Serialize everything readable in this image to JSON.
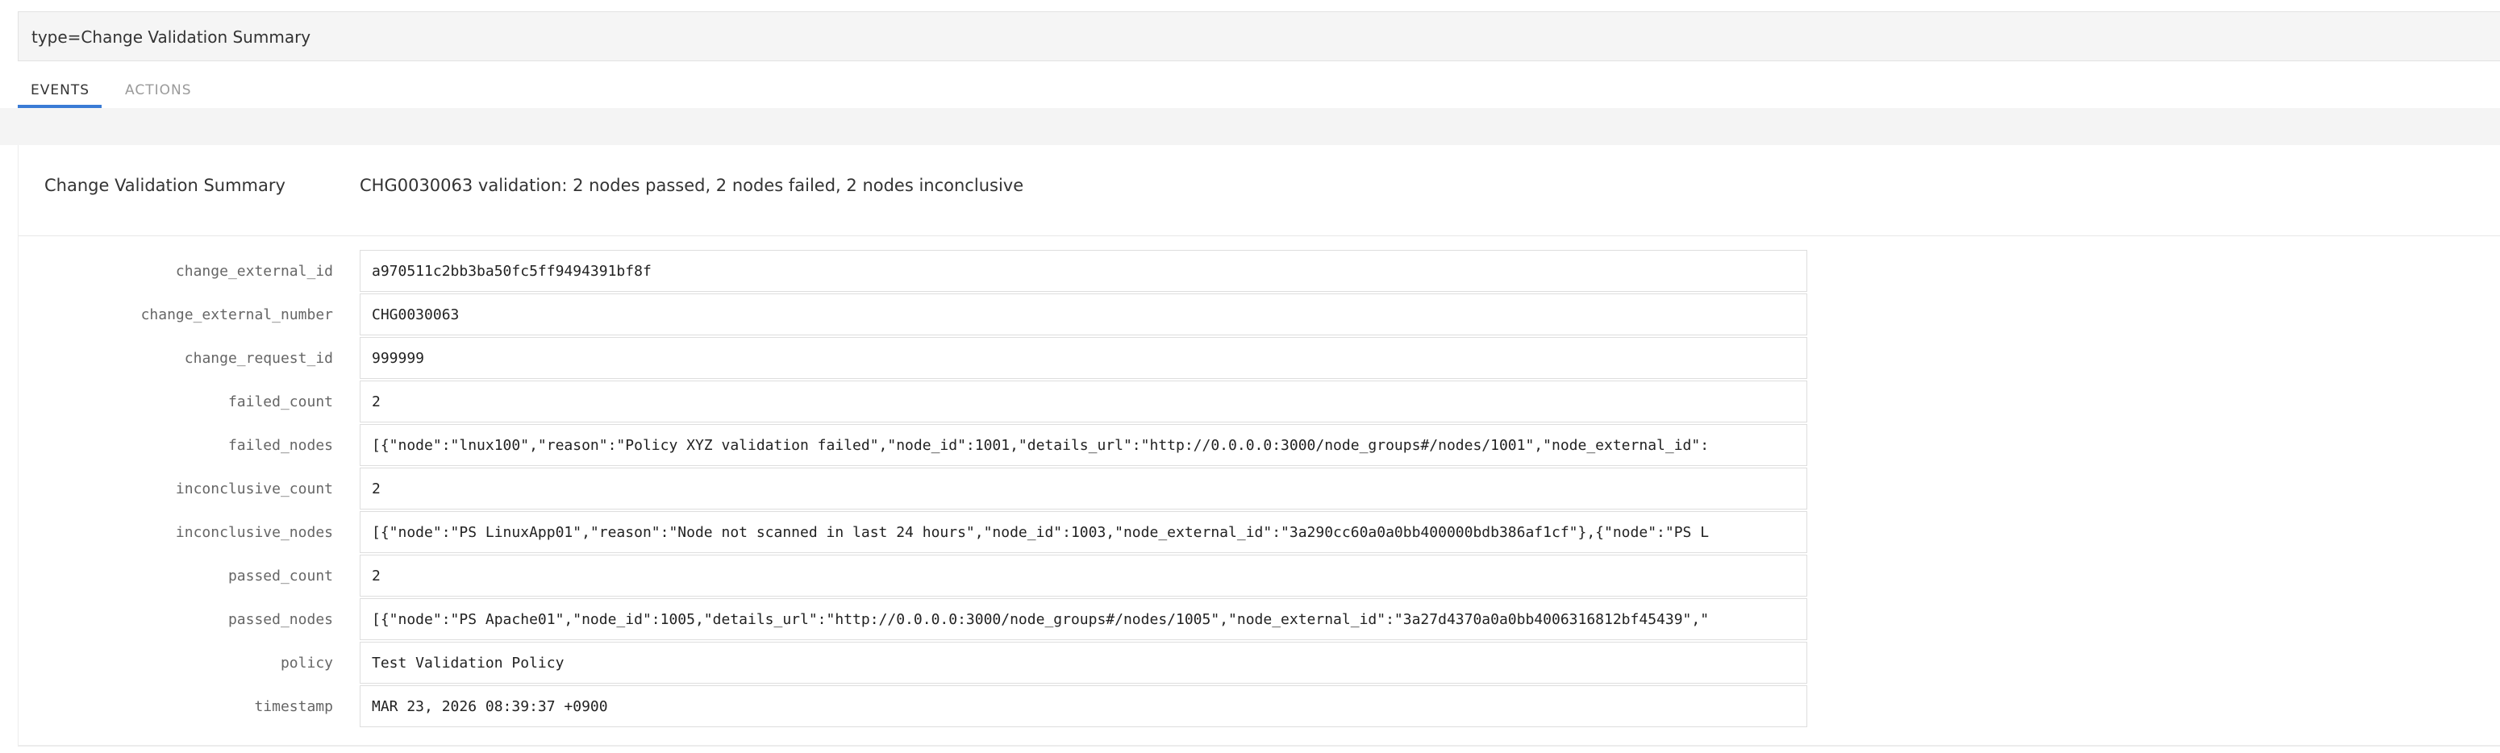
{
  "query": {
    "text": "type=Change Validation Summary"
  },
  "tabs": [
    {
      "label": "EVENTS",
      "active": true
    },
    {
      "label": "ACTIONS",
      "active": false
    }
  ],
  "accent_color": "#3a7bd5",
  "summary": {
    "label": "Change Validation Summary",
    "message": "CHG0030063 validation: 2 nodes passed, 2 nodes failed, 2 nodes inconclusive"
  },
  "fields": [
    {
      "key": "change_external_id",
      "value": "a970511c2bb3ba50fc5ff9494391bf8f"
    },
    {
      "key": "change_external_number",
      "value": "CHG0030063"
    },
    {
      "key": "change_request_id",
      "value": "999999"
    },
    {
      "key": "failed_count",
      "value": "2"
    },
    {
      "key": "failed_nodes",
      "value": "[{\"node\":\"lnux100\",\"reason\":\"Policy XYZ validation failed\",\"node_id\":1001,\"details_url\":\"http://0.0.0.0:3000/node_groups#/nodes/1001\",\"node_external_id\":"
    },
    {
      "key": "inconclusive_count",
      "value": "2"
    },
    {
      "key": "inconclusive_nodes",
      "value": "[{\"node\":\"PS LinuxApp01\",\"reason\":\"Node not scanned in last 24 hours\",\"node_id\":1003,\"node_external_id\":\"3a290cc60a0a0bb400000bdb386af1cf\"},{\"node\":\"PS L"
    },
    {
      "key": "passed_count",
      "value": "2"
    },
    {
      "key": "passed_nodes",
      "value": "[{\"node\":\"PS Apache01\",\"node_id\":1005,\"details_url\":\"http://0.0.0.0:3000/node_groups#/nodes/1005\",\"node_external_id\":\"3a27d4370a0a0bb4006316812bf45439\",\""
    },
    {
      "key": "policy",
      "value": "Test Validation Policy"
    },
    {
      "key": "timestamp",
      "value": "MAR 23, 2026 08:39:37 +0900"
    }
  ]
}
